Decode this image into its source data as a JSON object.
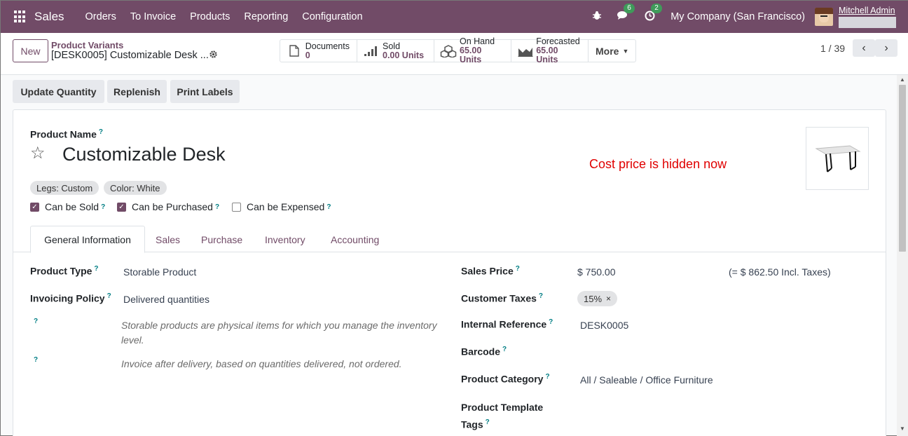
{
  "navbar": {
    "app_name": "Sales",
    "menu": [
      "Orders",
      "To Invoice",
      "Products",
      "Reporting",
      "Configuration"
    ],
    "messages_count": "6",
    "activities_count": "2",
    "company": "My Company (San Francisco)",
    "user_name": "Mitchell Admin"
  },
  "control_panel": {
    "new_label": "New",
    "breadcrumb_parent": "Product Variants",
    "breadcrumb_current": "[DESK0005] Customizable Desk ...",
    "smart_buttons": [
      {
        "label": "Documents",
        "value": "0"
      },
      {
        "label": "Sold",
        "value": "0.00 Units"
      },
      {
        "label": "On Hand",
        "value": "65.00 Units"
      },
      {
        "label": "Forecasted",
        "value": "65.00 Units"
      }
    ],
    "more_label": "More",
    "pager": "1 / 39"
  },
  "actions": [
    "Update Quantity",
    "Replenish",
    "Print Labels"
  ],
  "form": {
    "product_name_label": "Product Name",
    "product_name": "Customizable Desk",
    "cost_note": "Cost price is hidden now",
    "attributes": [
      "Legs: Custom",
      "Color: White"
    ],
    "checkboxes": [
      {
        "label": "Can be Sold",
        "checked": true
      },
      {
        "label": "Can be Purchased",
        "checked": true
      },
      {
        "label": "Can be Expensed",
        "checked": false
      }
    ],
    "tabs": [
      "General Information",
      "Sales",
      "Purchase",
      "Inventory",
      "Accounting"
    ],
    "help_mark": "?",
    "left": {
      "product_type_label": "Product Type",
      "product_type": "Storable Product",
      "invoicing_policy_label": "Invoicing Policy",
      "invoicing_policy": "Delivered quantities",
      "type_help_line1": "Storable products are physical items for which you manage the inventory",
      "type_help_line2": "level.",
      "invoice_help": "Invoice after delivery, based on quantities delivered, not ordered."
    },
    "right": {
      "sales_price_label": "Sales Price",
      "sales_price": "$ 750.00",
      "incl_taxes": "(= $ 862.50 Incl. Taxes)",
      "customer_taxes_label": "Customer Taxes",
      "customer_tax": "15%",
      "internal_ref_label": "Internal Reference",
      "internal_ref": "DESK0005",
      "barcode_label": "Barcode",
      "category_label": "Product Category",
      "category": "All / Saleable / Office Furniture",
      "template_tags_label_1": "Product Template",
      "template_tags_label_2": "Tags"
    }
  }
}
